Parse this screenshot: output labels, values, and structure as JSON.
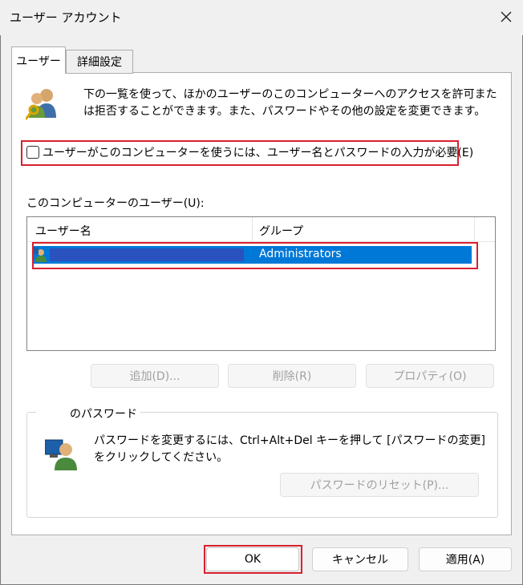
{
  "window": {
    "title": "ユーザー アカウント"
  },
  "tabs": [
    {
      "label": "ユーザー"
    },
    {
      "label": "詳細設定"
    }
  ],
  "users_tab": {
    "description": "下の一覧を使って、ほかのユーザーのこのコンピューターへのアクセスを許可または拒否することができます。また、パスワードやその他の設定を変更できます。",
    "require_login_checkbox": {
      "label": "ユーザーがこのコンピューターを使うには、ユーザー名とパスワードの入力が必要(E)",
      "checked": false
    },
    "users_label": "このコンピューターのユーザー(U):",
    "columns": [
      "ユーザー名",
      "グループ"
    ],
    "rows": [
      {
        "group": "Administrators",
        "selected": true
      }
    ],
    "buttons": {
      "add": "追加(D)...",
      "remove": "削除(R)",
      "properties": "プロパティ(O)"
    },
    "password_group": {
      "label": "のパスワード",
      "text": "パスワードを変更するには、Ctrl+Alt+Del キーを押して [パスワードの変更] をクリックしてください。",
      "reset_button": "パスワードのリセット(P)..."
    }
  },
  "footer": {
    "ok": "OK",
    "cancel": "キャンセル",
    "apply": "適用(A)"
  }
}
